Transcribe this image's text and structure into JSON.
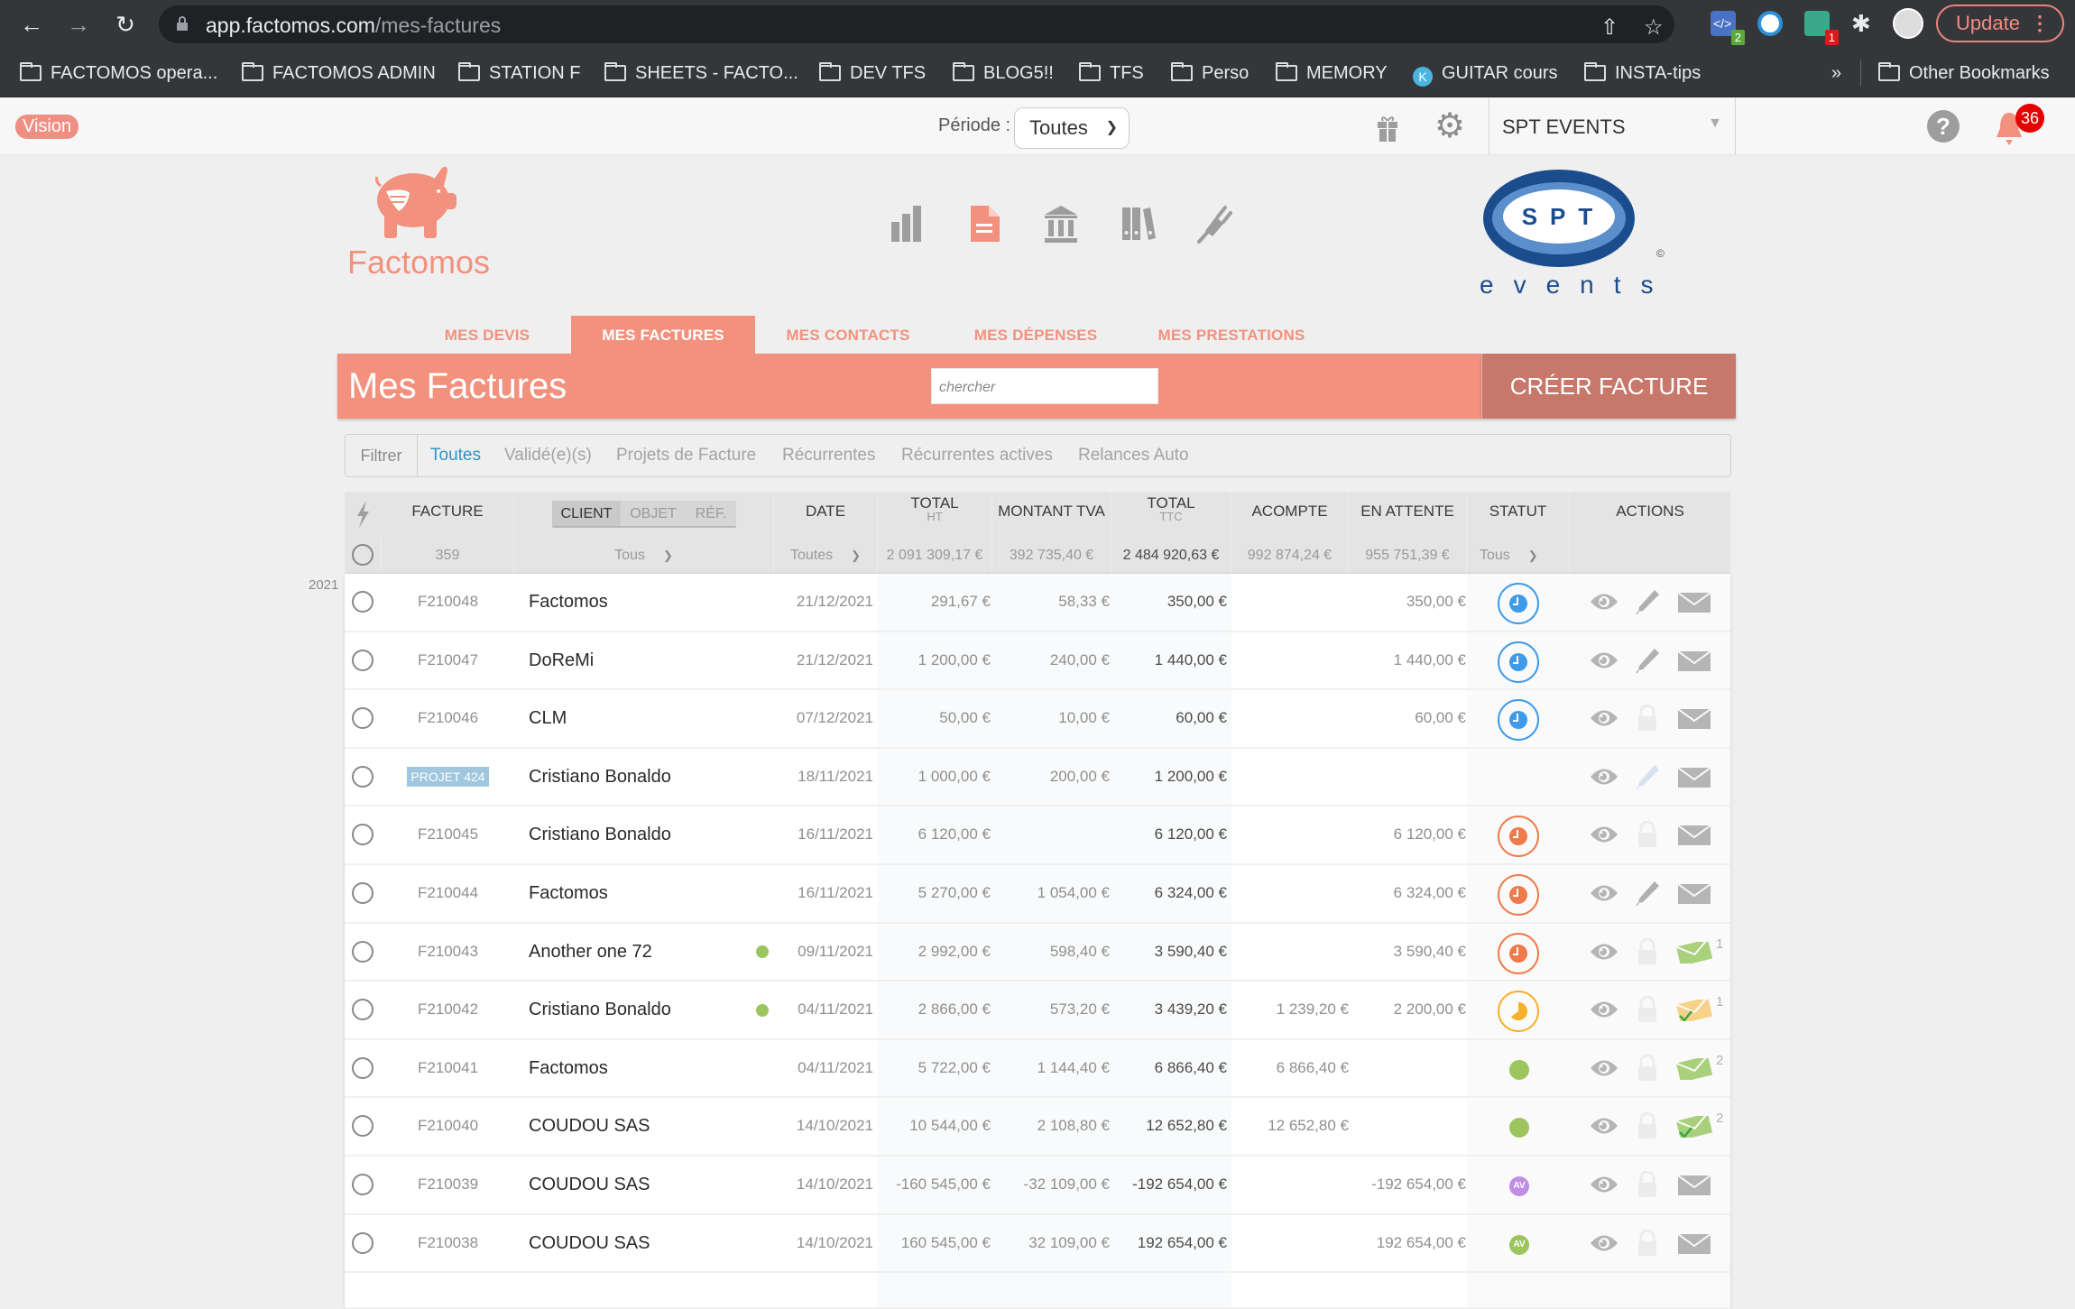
{
  "browser": {
    "url_host": "app.factomos.com",
    "url_path": "/mes-factures",
    "update_label": "Update",
    "extensions": [
      {
        "name": "code-extension",
        "badge": "2",
        "color": "#4a72c4",
        "badge_color": "#5aaa3a"
      },
      {
        "name": "password-extension",
        "badge": "",
        "color": "#2d8fd8",
        "badge_color": ""
      },
      {
        "name": "runner-extension",
        "badge": "1",
        "color": "#3aa98a",
        "badge_color": "#d81b1b"
      }
    ],
    "bookmarks": [
      {
        "label": "FACTOMOS opera...",
        "icon": "folder"
      },
      {
        "label": "FACTOMOS ADMIN",
        "icon": "folder"
      },
      {
        "label": "STATION F",
        "icon": "folder"
      },
      {
        "label": "SHEETS - FACTO...",
        "icon": "folder"
      },
      {
        "label": "DEV TFS",
        "icon": "folder"
      },
      {
        "label": "BLOG5!!",
        "icon": "folder"
      },
      {
        "label": "TFS",
        "icon": "folder"
      },
      {
        "label": "Perso",
        "icon": "folder"
      },
      {
        "label": "MEMORY",
        "icon": "folder"
      },
      {
        "label": "GUITAR cours",
        "icon": "k-logo"
      },
      {
        "label": "INSTA-tips",
        "icon": "folder"
      }
    ],
    "overflow_label": "»",
    "other_bookmarks": "Other Bookmarks"
  },
  "topbar": {
    "vision_label": "Vision",
    "periode_label": "Période :",
    "periode_value": "Toutes",
    "company": "SPT EVENTS",
    "help_label": "?",
    "notifications_count": "36"
  },
  "brand": {
    "name": "Factomos",
    "color": "#f2917d",
    "client_logo_text": "SPT",
    "client_logo_sub": "events",
    "client_logo_mark": "©"
  },
  "main_nav": [
    {
      "name": "stats",
      "active": false
    },
    {
      "name": "invoices",
      "active": true
    },
    {
      "name": "bank",
      "active": false
    },
    {
      "name": "archive",
      "active": false
    },
    {
      "name": "integrations",
      "active": false
    }
  ],
  "section_tabs": [
    {
      "label": "MES DEVIS",
      "active": false
    },
    {
      "label": "MES FACTURES",
      "active": true
    },
    {
      "label": "MES CONTACTS",
      "active": false
    },
    {
      "label": "MES DÉPENSES",
      "active": false
    },
    {
      "label": "MES PRESTATIONS",
      "active": false
    }
  ],
  "page": {
    "title": "Mes Factures",
    "search_placeholder": "chercher",
    "create_label": "CRÉER FACTURE"
  },
  "filters": {
    "label": "Filtrer",
    "items": [
      {
        "label": "Toutes",
        "active": true
      },
      {
        "label": "Validé(e)(s)",
        "active": false
      },
      {
        "label": "Projets de Facture",
        "active": false
      },
      {
        "label": "Récurrentes",
        "active": false
      },
      {
        "label": "Récurrentes actives",
        "active": false
      },
      {
        "label": "Relances Auto",
        "active": false
      }
    ]
  },
  "table": {
    "headers": {
      "facture": "FACTURE",
      "client_toggle": [
        "CLIENT",
        "OBJET",
        "RÉF."
      ],
      "date": "DATE",
      "total_ht": "TOTAL",
      "total_ht_sub": "HT",
      "tva": "MONTANT TVA",
      "total_ttc": "TOTAL",
      "total_ttc_sub": "TTC",
      "acompte": "ACOMPTE",
      "en_attente": "EN ATTENTE",
      "statut": "STATUT",
      "actions": "ACTIONS"
    },
    "summary": {
      "count": "359",
      "client_filter": "Tous",
      "date_filter": "Toutes",
      "total_ht": "2 091 309,17 €",
      "tva": "392 735,40 €",
      "total_ttc": "2 484 920,63 €",
      "acompte": "992 874,24 €",
      "en_attente": "955 751,39 €",
      "statut_filter": "Tous"
    },
    "year_label": "2021",
    "rows": [
      {
        "num": "F210048",
        "projet": false,
        "client": "Factomos",
        "dot": false,
        "date": "21/12/2021",
        "ht": "291,67 €",
        "tva": "58,33 €",
        "ttc": "350,00 €",
        "acompte": "",
        "attente": "350,00 €",
        "status": "pending-blue",
        "edit": "pencil",
        "mail": "grey",
        "mail_count": ""
      },
      {
        "num": "F210047",
        "projet": false,
        "client": "DoReMi",
        "dot": false,
        "date": "21/12/2021",
        "ht": "1 200,00 €",
        "tva": "240,00 €",
        "ttc": "1 440,00 €",
        "acompte": "",
        "attente": "1 440,00 €",
        "status": "pending-blue",
        "edit": "pencil",
        "mail": "grey",
        "mail_count": ""
      },
      {
        "num": "F210046",
        "projet": false,
        "client": "CLM",
        "dot": false,
        "date": "07/12/2021",
        "ht": "50,00 €",
        "tva": "10,00 €",
        "ttc": "60,00 €",
        "acompte": "",
        "attente": "60,00 €",
        "status": "pending-blue",
        "edit": "lock",
        "mail": "grey",
        "mail_count": ""
      },
      {
        "num": "PROJET 424",
        "projet": true,
        "client": "Cristiano Bonaldo",
        "dot": false,
        "date": "18/11/2021",
        "ht": "1 000,00 €",
        "tva": "200,00 €",
        "ttc": "1 200,00 €",
        "acompte": "",
        "attente": "",
        "status": "none",
        "edit": "pencil-light",
        "mail": "grey",
        "mail_count": ""
      },
      {
        "num": "F210045",
        "projet": false,
        "client": "Cristiano Bonaldo",
        "dot": false,
        "date": "16/11/2021",
        "ht": "6 120,00 €",
        "tva": "",
        "ttc": "6 120,00 €",
        "acompte": "",
        "attente": "6 120,00 €",
        "status": "late-orange",
        "edit": "lock",
        "mail": "grey",
        "mail_count": ""
      },
      {
        "num": "F210044",
        "projet": false,
        "client": "Factomos",
        "dot": false,
        "date": "16/11/2021",
        "ht": "5 270,00 €",
        "tva": "1 054,00 €",
        "ttc": "6 324,00 €",
        "acompte": "",
        "attente": "6 324,00 €",
        "status": "late-orange",
        "edit": "pencil",
        "mail": "grey",
        "mail_count": ""
      },
      {
        "num": "F210043",
        "projet": false,
        "client": "Another one 72",
        "dot": true,
        "date": "09/11/2021",
        "ht": "2 992,00 €",
        "tva": "598,40 €",
        "ttc": "3 590,40 €",
        "acompte": "",
        "attente": "3 590,40 €",
        "status": "late-orange",
        "edit": "lock",
        "mail": "green",
        "mail_count": "1"
      },
      {
        "num": "F210042",
        "projet": false,
        "client": "Cristiano Bonaldo",
        "dot": true,
        "date": "04/11/2021",
        "ht": "2 866,00 €",
        "tva": "573,20 €",
        "ttc": "3 439,20 €",
        "acompte": "1 239,20 €",
        "attente": "2 200,00 €",
        "status": "partial-yellow",
        "edit": "lock",
        "mail": "yellow-check",
        "mail_count": "1"
      },
      {
        "num": "F210041",
        "projet": false,
        "client": "Factomos",
        "dot": false,
        "date": "04/11/2021",
        "ht": "5 722,00 €",
        "tva": "1 144,40 €",
        "ttc": "6 866,40 €",
        "acompte": "6 866,40 €",
        "attente": "",
        "status": "paid-green",
        "edit": "lock",
        "mail": "green",
        "mail_count": "2"
      },
      {
        "num": "F210040",
        "projet": false,
        "client": "COUDOU SAS",
        "dot": false,
        "date": "14/10/2021",
        "ht": "10 544,00 €",
        "tva": "2 108,80 €",
        "ttc": "12 652,80 €",
        "acompte": "12 652,80 €",
        "attente": "",
        "status": "paid-green",
        "edit": "lock",
        "mail": "green-check",
        "mail_count": "2"
      },
      {
        "num": "F210039",
        "projet": false,
        "client": "COUDOU SAS",
        "dot": false,
        "date": "14/10/2021",
        "ht": "-160 545,00 €",
        "tva": "-32 109,00 €",
        "ttc": "-192 654,00 €",
        "acompte": "",
        "attente": "-192 654,00 €",
        "status": "avoir-purple",
        "edit": "lock",
        "mail": "grey",
        "mail_count": ""
      },
      {
        "num": "F210038",
        "projet": false,
        "client": "COUDOU SAS",
        "dot": false,
        "date": "14/10/2021",
        "ht": "160 545,00 €",
        "tva": "32 109,00 €",
        "ttc": "192 654,00 €",
        "acompte": "",
        "attente": "192 654,00 €",
        "status": "avoir-green",
        "edit": "lock",
        "mail": "grey",
        "mail_count": ""
      }
    ],
    "status_colors": {
      "pending-blue": "#3d9be9",
      "late-orange": "#f07a4a",
      "partial-yellow": "#f7b02a",
      "paid-green": "#9cc55e",
      "avoir-purple": "#c18ee6",
      "avoir-green": "#9cc55e"
    },
    "avoir_label": "AV"
  }
}
